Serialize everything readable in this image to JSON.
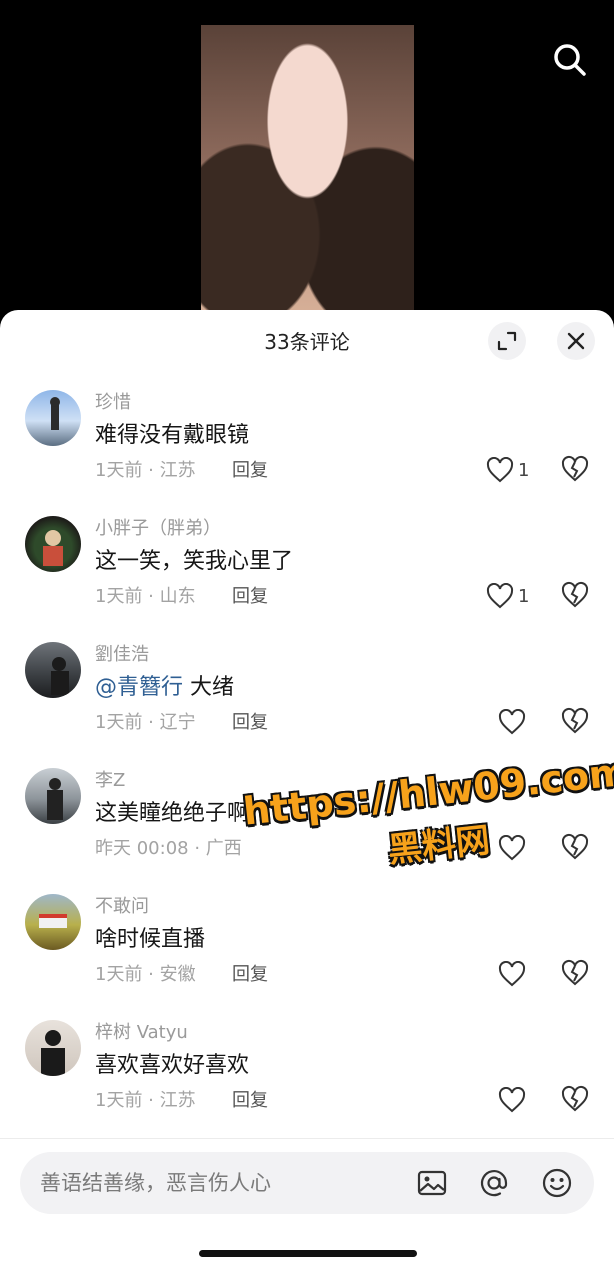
{
  "header": {
    "comment_count_title": "33条评论"
  },
  "comments": [
    {
      "user": "珍惜",
      "text": "难得没有戴眼镜",
      "meta": "1天前 · 江苏",
      "reply": "回复",
      "likes": "1"
    },
    {
      "user": "小胖子（胖弟）",
      "text": "这一笑，笑我心里了",
      "meta": "1天前 · 山东",
      "reply": "回复",
      "likes": "1"
    },
    {
      "user": "劉佳浩",
      "mention": "@青簪行",
      "text": " 大绪",
      "meta": "1天前 · 辽宁",
      "reply": "回复",
      "likes": ""
    },
    {
      "user": "李Z",
      "text": "这美瞳绝绝子啊",
      "meta": "昨天 00:08 · 广西",
      "reply": "回复",
      "likes": ""
    },
    {
      "user": "不敢问",
      "text": "啥时候直播",
      "meta": "1天前 · 安徽",
      "reply": "回复",
      "likes": ""
    },
    {
      "user": "梓树 Vatyu",
      "text": "喜欢喜欢好喜欢",
      "meta": "1天前 · 江苏",
      "reply": "回复",
      "likes": ""
    }
  ],
  "input": {
    "placeholder": "善语结善缘，恶言伤人心"
  },
  "icons": {
    "search": "search-icon",
    "expand": "expand-icon",
    "close": "close-icon",
    "like": "heart-icon",
    "dislike": "broken-heart-icon",
    "image": "image-icon",
    "at": "at-icon",
    "emoji": "emoji-icon"
  },
  "watermark": {
    "url": "https://hlw09.com",
    "name": "黑料网"
  },
  "colors": {
    "mention": "#2f5f93",
    "watermark": "#f7a21b"
  }
}
